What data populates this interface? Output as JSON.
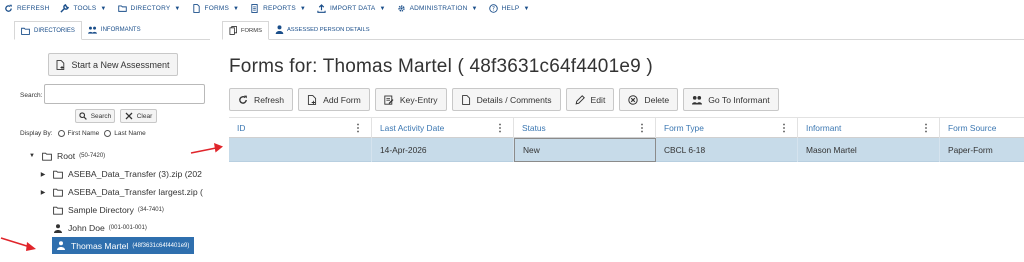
{
  "menubar": {
    "items": [
      {
        "label": "REFRESH",
        "icon": "refresh-icon",
        "has_caret": false
      },
      {
        "label": "TOOLS",
        "icon": "wrench-icon",
        "has_caret": true
      },
      {
        "label": "DIRECTORY",
        "icon": "folder-icon",
        "has_caret": true
      },
      {
        "label": "FORMS",
        "icon": "document-icon",
        "has_caret": true
      },
      {
        "label": "REPORTS",
        "icon": "report-icon",
        "has_caret": true
      },
      {
        "label": "IMPORT DATA",
        "icon": "upload-icon",
        "has_caret": true
      },
      {
        "label": "ADMINISTRATION",
        "icon": "gear-icon",
        "has_caret": true
      },
      {
        "label": "HELP",
        "icon": "help-icon",
        "has_caret": true
      }
    ],
    "caret": "▼"
  },
  "left_panel": {
    "tabs": [
      {
        "label": "DIRECTORIES",
        "active": true
      },
      {
        "label": "INFORMANTS",
        "active": false
      }
    ],
    "new_assessment_label": "Start a New Assessment",
    "search": {
      "label": "Search:",
      "value": "",
      "search_button": "Search",
      "clear_button": "Clear"
    },
    "display_by": {
      "label": "Display By:",
      "options": [
        "First Name",
        "Last Name"
      ],
      "selected": ""
    },
    "tree": {
      "root": {
        "name": "Root",
        "id": "(50-7420)"
      },
      "items": [
        {
          "name": "ASEBA_Data_Transfer (3).zip (202",
          "id": "",
          "type": "folder",
          "expandable": true
        },
        {
          "name": "ASEBA_Data_Transfer largest.zip (",
          "id": "",
          "type": "folder",
          "expandable": true
        },
        {
          "name": "Sample Directory",
          "id": "(34-7401)",
          "type": "folder",
          "expandable": false
        },
        {
          "name": "John Doe",
          "id": "(001-001-001)",
          "type": "person",
          "expandable": false
        },
        {
          "name": "Thomas Martel",
          "id": "(48f3631c64f4401e9)",
          "type": "person",
          "expandable": false,
          "selected": true
        }
      ]
    }
  },
  "right_panel": {
    "tabs": [
      {
        "label": "FORMS",
        "active": true
      },
      {
        "label": "ASSESSED PERSON DETAILS",
        "active": false
      }
    ],
    "title": "Forms for:  Thomas Martel  ( 48f3631c64f4401e9 )",
    "toolbar": {
      "refresh": "Refresh",
      "add_form": "Add Form",
      "key_entry": "Key-Entry",
      "details": "Details / Comments",
      "edit": "Edit",
      "delete": "Delete",
      "go_to_informant": "Go To Informant"
    },
    "grid": {
      "columns": [
        "ID",
        "Last Activity Date",
        "Status",
        "Form Type",
        "Informant",
        "Form Source"
      ],
      "rows": [
        [
          "",
          "14-Apr-2026",
          "New",
          "CBCL 6-18",
          "Mason Martel",
          "Paper-Form"
        ]
      ],
      "column_menu_glyph": "⋮"
    }
  },
  "colors": {
    "accent": "#1a4e8a",
    "selected_tree_bg": "#2f6fae",
    "selected_row_bg": "#c7dbe9",
    "header_text": "#3b77b2",
    "annotation_arrow": "#e0252b"
  }
}
